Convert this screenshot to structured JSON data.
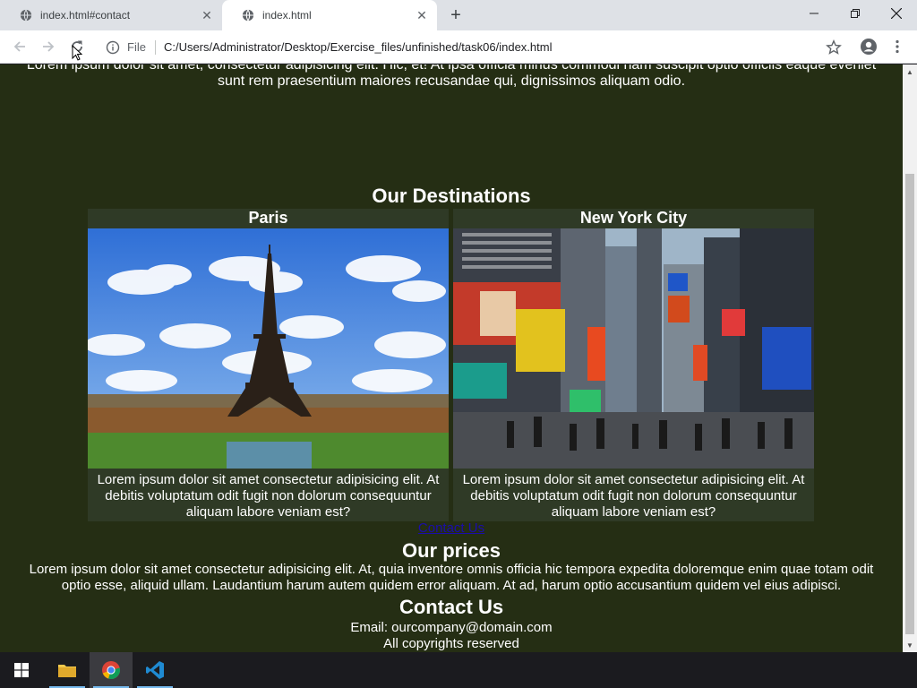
{
  "browser": {
    "tabs": [
      {
        "title": "index.html#contact",
        "active": false
      },
      {
        "title": "index.html",
        "active": true
      }
    ],
    "address": {
      "scheme_label": "File",
      "url": "C:/Users/Administrator/Desktop/Exercise_files/unfinished/task06/index.html"
    }
  },
  "page": {
    "intro_line1": "Lorem ipsum dolor sit amet, consectetur adipisicing elit. Hic, et! At ipsa officia minus commodi nam suscipit optio officiis eaque eveniet",
    "intro_line2": "sunt rem praesentium maiores recusandae qui, dignissimos aliquam odio.",
    "destinations_title": "Our Destinations",
    "destinations": [
      {
        "name": "Paris",
        "text": "Lorem ipsum dolor sit amet consectetur adipisicing elit. At debitis voluptatum odit fugit non dolorum consequuntur aliquam labore veniam est?"
      },
      {
        "name": "New York City",
        "text": "Lorem ipsum dolor sit amet consectetur adipisicing elit. At debitis voluptatum odit fugit non dolorum consequuntur aliquam labore veniam est?"
      }
    ],
    "contact_link": "Contact Us",
    "prices_title": "Our prices",
    "prices_line1": "Lorem ipsum dolor sit amet consectetur adipisicing elit. At, quia inventore omnis officia hic tempora expedita doloremque enim quae totam odit",
    "prices_line2": "optio esse, aliquid ullam. Laudantium harum autem quidem error aliquam. At ad, harum optio accusantium quidem vel eius adipisci.",
    "contact_title": "Contact Us",
    "email": "Email: ourcompany@domain.com",
    "copyright": "All copyrights reserved"
  },
  "colors": {
    "page_background": "#252e14",
    "card_background": "#2f3a26",
    "link": "#1a0dab",
    "taskbar": "#1b1b1f"
  },
  "taskbar": {
    "items": [
      "start-icon",
      "file-explorer-icon",
      "chrome-icon",
      "vscode-icon"
    ]
  }
}
